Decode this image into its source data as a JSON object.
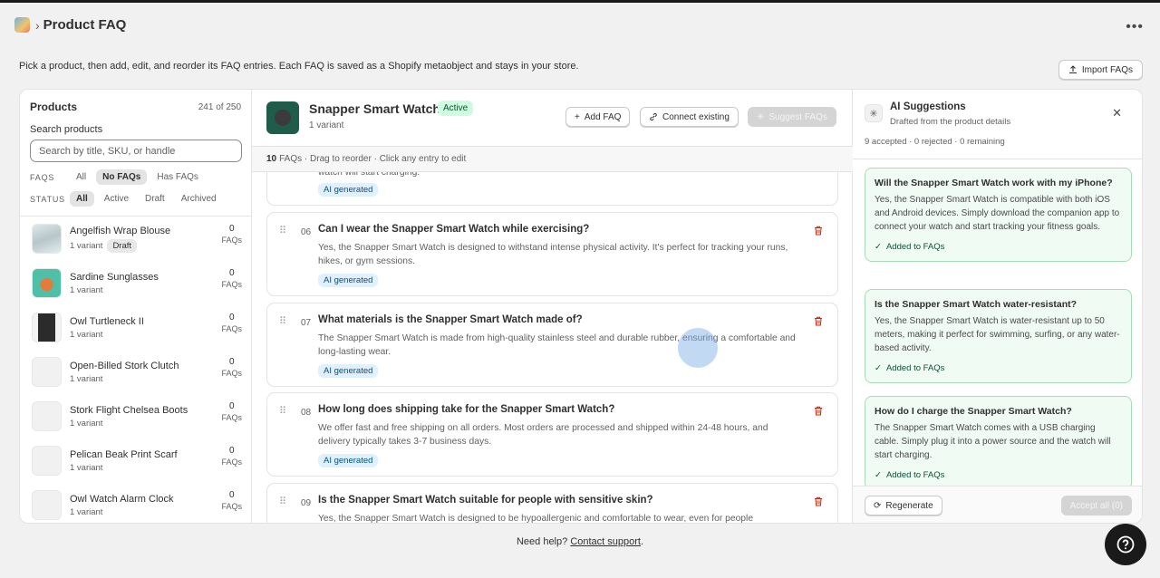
{
  "header": {
    "title": "Product FAQ",
    "more_label": "•••"
  },
  "intro": "Pick a product, then add, edit, and reorder its FAQ entries. Each FAQ is saved as a Shopify metaobject and stays in your store.",
  "import_label": "Import FAQs",
  "products": {
    "title": "Products",
    "count": "241 of 250",
    "search_label": "Search products",
    "search_placeholder": "Search by title, SKU, or handle",
    "faq_filter": {
      "label": "FAQS",
      "options": [
        "All",
        "No FAQs",
        "Has FAQs"
      ],
      "selected": "No FAQs"
    },
    "status_filter": {
      "label": "STATUS",
      "options": [
        "All",
        "Active",
        "Draft",
        "Archived"
      ],
      "selected": "All"
    },
    "faqs_unit": "FAQs",
    "items": [
      {
        "name": "Angelfish Wrap Blouse",
        "variant": "1 variant",
        "badge": "Draft",
        "faqs": "0"
      },
      {
        "name": "Sardine Sunglasses",
        "variant": "1 variant",
        "badge": "",
        "faqs": "0"
      },
      {
        "name": "Owl Turtleneck II",
        "variant": "1 variant",
        "badge": "",
        "faqs": "0"
      },
      {
        "name": "Open-Billed Stork Clutch",
        "variant": "1 variant",
        "badge": "",
        "faqs": "0"
      },
      {
        "name": "Stork Flight Chelsea Boots",
        "variant": "1 variant",
        "badge": "",
        "faqs": "0"
      },
      {
        "name": "Pelican Beak Print Scarf",
        "variant": "1 variant",
        "badge": "",
        "faqs": "0"
      },
      {
        "name": "Owl Watch Alarm Clock",
        "variant": "1 variant",
        "badge": "",
        "faqs": "0"
      }
    ]
  },
  "product": {
    "title": "Snapper Smart Watch",
    "status": "Active",
    "variants": "1 variant",
    "add_label": "Add FAQ",
    "connect_label": "Connect existing",
    "suggest_label": "Suggest FAQs",
    "faq_count": "10",
    "bar_text": "FAQs · Drag to reorder · Click any entry to edit"
  },
  "faqs": {
    "tag": "AI generated",
    "partial_answer": "watch will start charging.",
    "items": [
      {
        "num": "06",
        "q": "Can I wear the Snapper Smart Watch while exercising?",
        "a": "Yes, the Snapper Smart Watch is designed to withstand intense physical activity. It's perfect for tracking your runs, hikes, or gym sessions."
      },
      {
        "num": "07",
        "q": "What materials is the Snapper Smart Watch made of?",
        "a": "The Snapper Smart Watch is made from high-quality stainless steel and durable rubber, ensuring a comfortable and long-lasting wear."
      },
      {
        "num": "08",
        "q": "How long does shipping take for the Snapper Smart Watch?",
        "a": "We offer fast and free shipping on all orders. Most orders are processed and shipped within 24-48 hours, and delivery typically takes 3-7 business days."
      },
      {
        "num": "09",
        "q": "Is the Snapper Smart Watch suitable for people with sensitive skin?",
        "a": "Yes, the Snapper Smart Watch is designed to be hypoallergenic and comfortable to wear, even for people"
      }
    ]
  },
  "ai": {
    "title": "AI Suggestions",
    "subtitle": "Drafted from the product details",
    "stats": "9 accepted · 0 rejected · 0 remaining",
    "added_label": "Added to FAQs",
    "suggestions": [
      {
        "q": "Will the Snapper Smart Watch work with my iPhone?",
        "a": "Yes, the Snapper Smart Watch is compatible with both iOS and Android devices. Simply download the companion app to connect your watch and start tracking your fitness goals."
      },
      {
        "q": "Is the Snapper Smart Watch water-resistant?",
        "a": "Yes, the Snapper Smart Watch is water-resistant up to 50 meters, making it perfect for swimming, surfing, or any water-based activity."
      },
      {
        "q": "How do I charge the Snapper Smart Watch?",
        "a": "The Snapper Smart Watch comes with a USB charging cable. Simply plug it into a power source and the watch will start charging."
      }
    ],
    "regenerate_label": "Regenerate",
    "accept_label": "Accept all (0)"
  },
  "footer": {
    "help_text": "Need help?",
    "contact_label": "Contact support",
    "period": "."
  }
}
